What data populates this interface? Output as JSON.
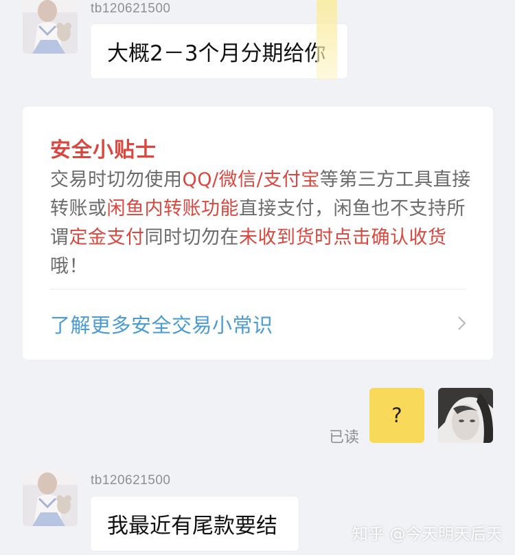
{
  "messages": [
    {
      "sender": "tb120621500",
      "text": "大概2－3个月分期给你"
    },
    {
      "sender": "tb120621500",
      "text": "我最近有尾款要结"
    }
  ],
  "safety_tips": {
    "title": "安全小贴士",
    "segments": [
      {
        "text": "交易时切勿使用",
        "highlight": false
      },
      {
        "text": "QQ/微信/支付宝",
        "highlight": true
      },
      {
        "text": "等第三方工具直接转账或",
        "highlight": false
      },
      {
        "text": "闲鱼内转账功能",
        "highlight": true
      },
      {
        "text": "直接支付，闲鱼也不支持所谓",
        "highlight": false
      },
      {
        "text": "定金支付",
        "highlight": true
      },
      {
        "text": "同时切勿在",
        "highlight": false
      },
      {
        "text": "未收到货时点击确认收货",
        "highlight": true
      },
      {
        "text": "哦！",
        "highlight": false
      }
    ],
    "link_text": "了解更多安全交易小常识"
  },
  "my_message": {
    "text": "?",
    "status": "已读"
  },
  "watermark": "知乎 @今天明天后天",
  "colors": {
    "background": "#f1f2f5",
    "highlight_red": "#d9473e",
    "link_blue": "#4a9bd4",
    "my_bubble_yellow": "#f8d959"
  }
}
